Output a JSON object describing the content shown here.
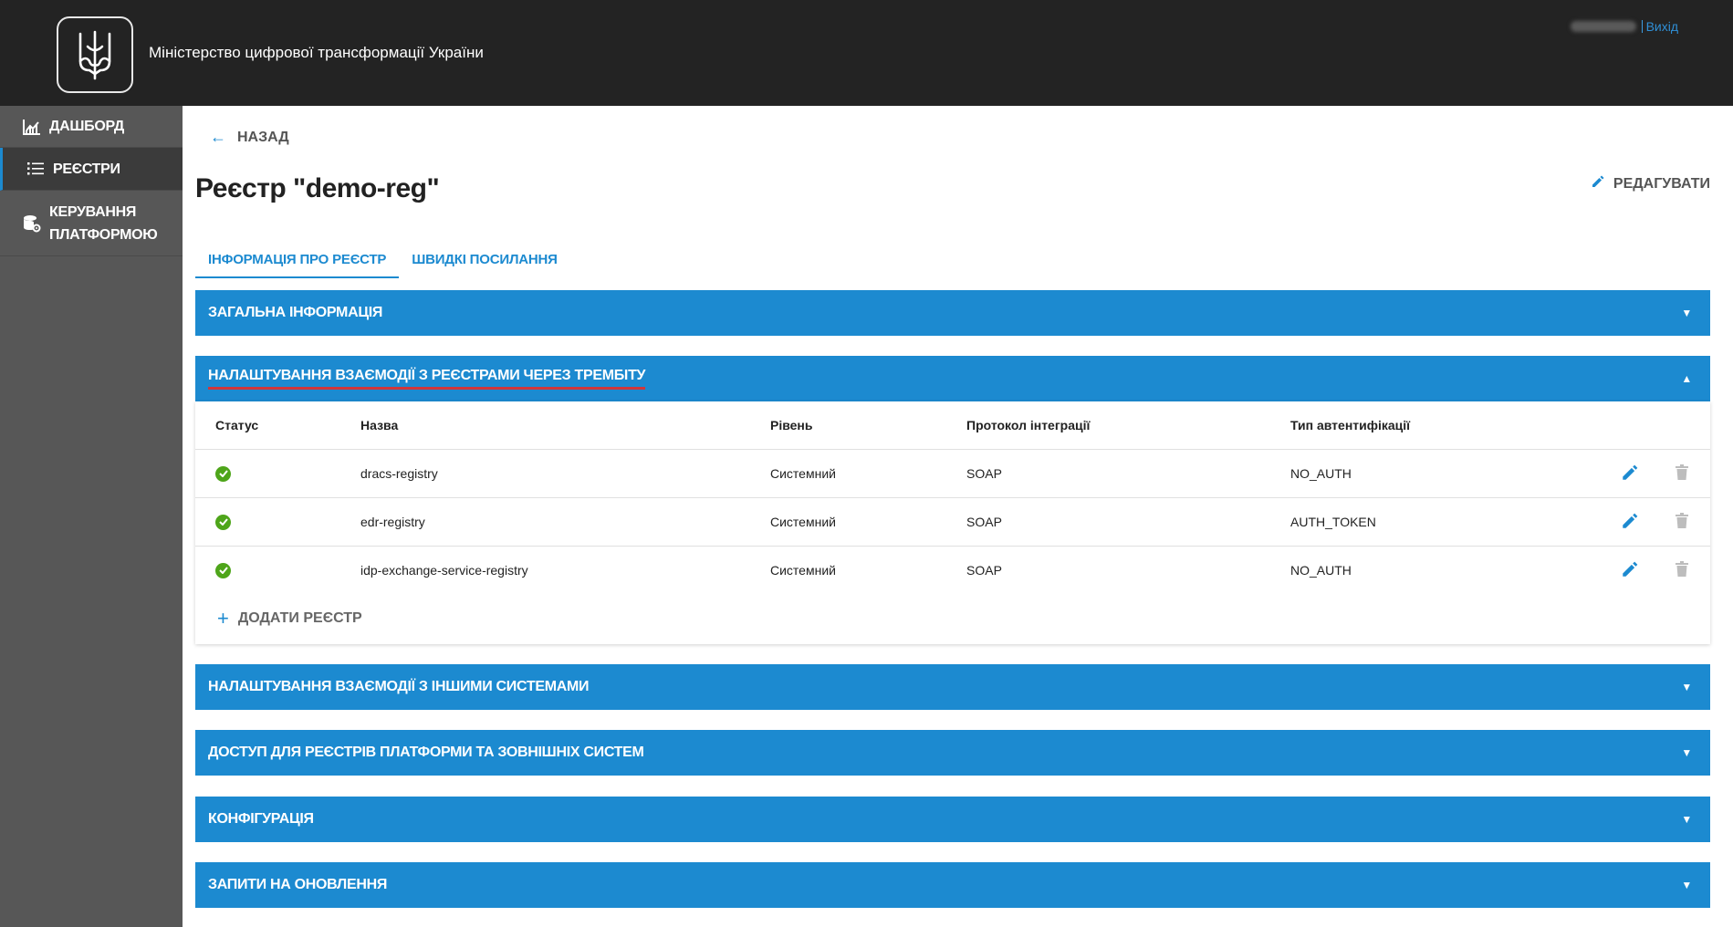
{
  "header": {
    "org_name": "Міністерство цифрової трансформації України",
    "logout_label": "Вихід"
  },
  "sidebar": {
    "items": [
      {
        "label": "Дашборд",
        "icon": "chart-icon"
      },
      {
        "label": "Реєстри",
        "icon": "list-icon"
      },
      {
        "label": "Керування платформою",
        "icon": "database-settings-icon"
      }
    ]
  },
  "main": {
    "back_label": "Назад",
    "title": "Реєстр \"demo-reg\"",
    "edit_label": "Редагувати",
    "tabs": [
      {
        "label": "Інформація про реєстр"
      },
      {
        "label": "Швидкі посилання"
      }
    ],
    "sections": [
      {
        "title": "Загальна інформація"
      },
      {
        "title": "Налаштування взаємодії з реєстрами через Трембіту"
      },
      {
        "title": "Налаштування взаємодії з іншими системами"
      },
      {
        "title": "Доступ для реєстрів платформи та зовнішніх систем"
      },
      {
        "title": "Конфігурація"
      },
      {
        "title": "Запити на оновлення"
      }
    ],
    "table": {
      "headers": [
        "Статус",
        "Назва",
        "Рівень",
        "Протокол інтеграції",
        "Тип автентифікації"
      ],
      "rows": [
        {
          "name": "dracs-registry",
          "level": "Системний",
          "protocol": "SOAP",
          "auth": "NO_AUTH"
        },
        {
          "name": "edr-registry",
          "level": "Системний",
          "protocol": "SOAP",
          "auth": "AUTH_TOKEN"
        },
        {
          "name": "idp-exchange-service-registry",
          "level": "Системний",
          "protocol": "SOAP",
          "auth": "NO_AUTH"
        }
      ]
    },
    "add_registry_label": "Додати реєстр"
  },
  "colors": {
    "accent": "#1c8ad0",
    "header_bg": "#232323",
    "sidebar_bg": "#575757",
    "status_ok": "#4ea51a",
    "highlight_underline": "#d0363a"
  }
}
